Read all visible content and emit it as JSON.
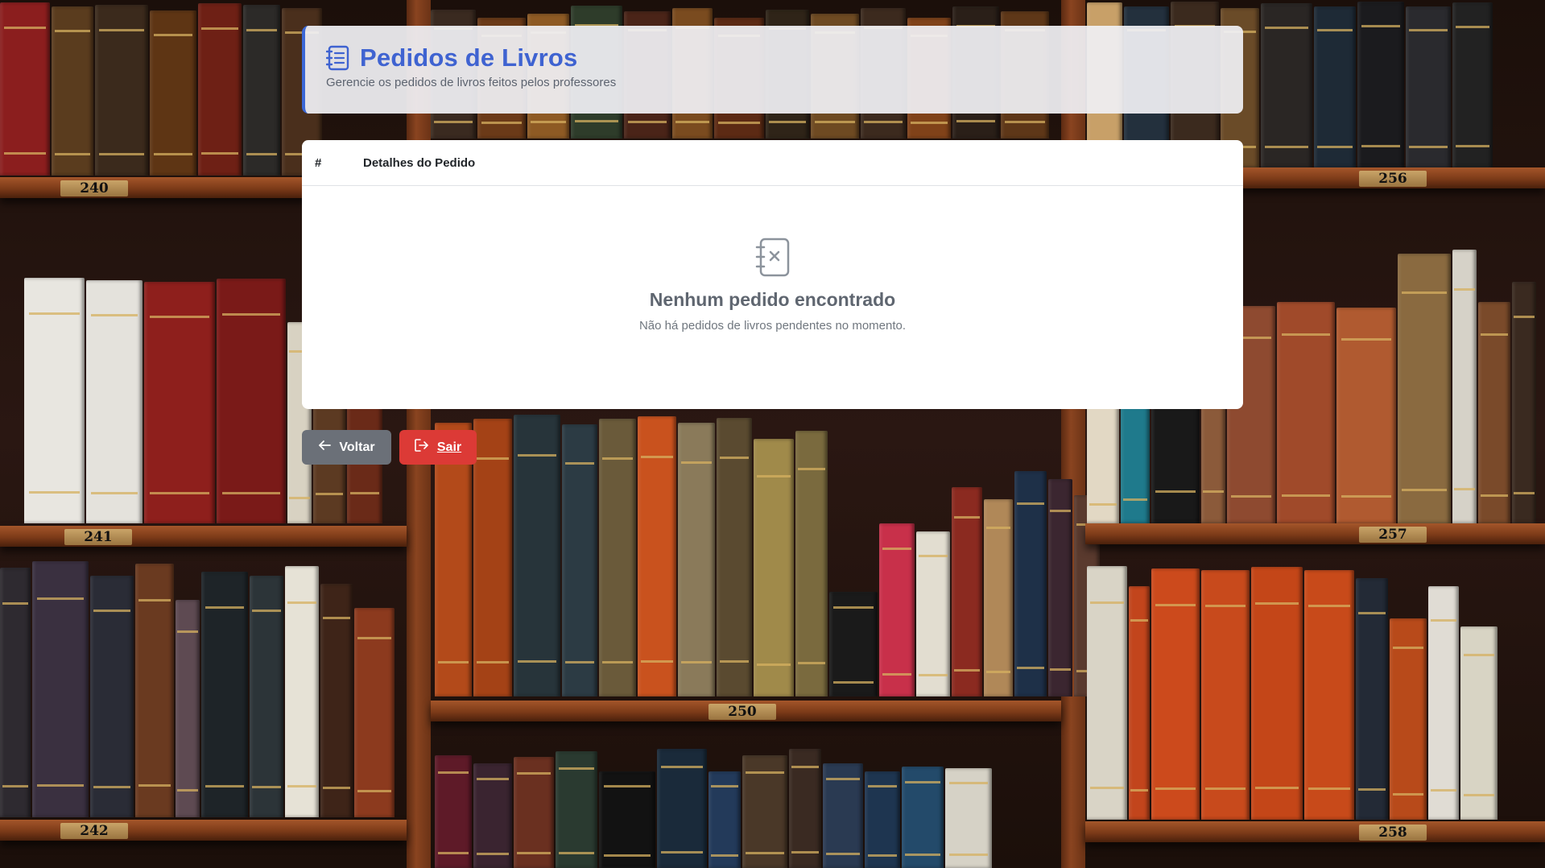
{
  "header": {
    "icon": "list-document-icon",
    "title": "Pedidos de Livros",
    "subtitle": "Gerencie os pedidos de livros feitos pelos professores",
    "accent_color": "#3f63d1"
  },
  "table": {
    "columns": [
      "#",
      "Detalhes do Pedido"
    ],
    "empty_state": {
      "icon": "empty-notebook-icon",
      "title": "Nenhum pedido encontrado",
      "message": "Não há pedidos de livros pendentes no momento."
    }
  },
  "actions": {
    "back": {
      "label": "Voltar",
      "icon": "arrow-left-icon",
      "color": "#6b7078"
    },
    "exit": {
      "label": "Sair",
      "icon": "logout-icon",
      "color": "#dc3a36"
    }
  },
  "background": {
    "shelf_numbers": [
      "240",
      "256",
      "241",
      "250",
      "257",
      "242",
      "258"
    ]
  }
}
